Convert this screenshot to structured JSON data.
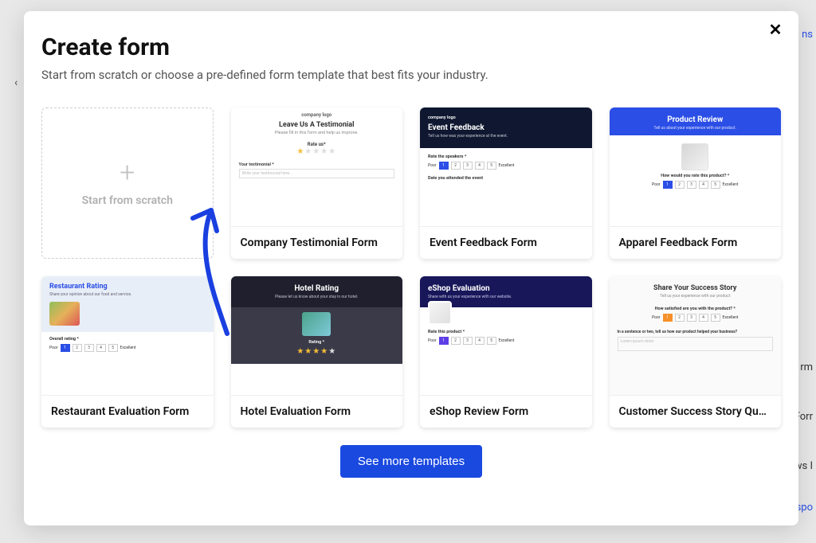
{
  "modal": {
    "title": "Create form",
    "subtitle": "Start from scratch or choose a pre-defined form template that best fits your industry.",
    "close_label": "✕",
    "see_more_label": "See more templates"
  },
  "scratch": {
    "plus": "+",
    "label": "Start from scratch"
  },
  "templates": [
    {
      "id": "testimonial",
      "label": "Company Testimonial Form",
      "preview": {
        "logo": "company logo",
        "title": "Leave Us A Testimonial",
        "subtitle": "Please fill in this form and help us improve.",
        "rate_label": "Rate us*",
        "stars_filled": 1,
        "stars_total": 5,
        "field_label": "Your testimonial *",
        "field_placeholder": "Write your testimonial here..."
      }
    },
    {
      "id": "event",
      "label": "Event Feedback Form",
      "preview": {
        "logo": "company logo",
        "title": "Event Feedback",
        "subtitle": "Tell us how was your experience at the event.",
        "question": "Rate the speakers *",
        "rating_labels": [
          "Poor",
          "1",
          "2",
          "3",
          "4",
          "5",
          "Excellent"
        ],
        "rating_active_index": 1,
        "date_label": "Date you attended the event"
      }
    },
    {
      "id": "apparel",
      "label": "Apparel Feedback Form",
      "preview": {
        "title": "Product Review",
        "subtitle": "Tell us about your experience with our product.",
        "question": "How would you rate this product? *",
        "rating_labels": [
          "Poor",
          "1",
          "2",
          "3",
          "4",
          "5",
          "Excellent"
        ],
        "rating_active_index": 1
      }
    },
    {
      "id": "restaurant",
      "label": "Restaurant Evaluation Form",
      "preview": {
        "title": "Restaurant Rating",
        "subtitle": "Share your opinion about our food and service.",
        "question": "Overall rating *",
        "rating_labels": [
          "Poor",
          "1",
          "2",
          "3",
          "4",
          "5",
          "Excellent"
        ],
        "rating_active_index": 1
      }
    },
    {
      "id": "hotel",
      "label": "Hotel Evaluation Form",
      "preview": {
        "title": "Hotel Rating",
        "subtitle": "Please let us know about your stay in our hotel.",
        "rating_label": "Rating *",
        "stars_filled": 4,
        "stars_total": 5
      }
    },
    {
      "id": "eshop",
      "label": "eShop Review Form",
      "preview": {
        "title": "eShop Evaluation",
        "subtitle": "Share with us your experience with our website.",
        "question": "Rate this product *",
        "rating_labels": [
          "Poor",
          "1",
          "2",
          "3",
          "4",
          "5",
          "Excellent"
        ],
        "rating_active_index": 1
      }
    },
    {
      "id": "story",
      "label": "Customer Success Story Questionnaire",
      "preview": {
        "title": "Share Your Success Story",
        "subtitle": "Tell us your experience with our product",
        "question1": "How satisfied are you with the product? *",
        "rating_labels": [
          "Poor",
          "1",
          "2",
          "3",
          "4",
          "5",
          "Excellent"
        ],
        "rating_active_index": 1,
        "question2": "In a sentence or two, tell us how our product helped your business?",
        "placeholder": "Lorem ipsum dolor"
      }
    }
  ],
  "bg": {
    "right1": "ns",
    "right2": "rm",
    "right3": "Forr",
    "right4": "ws I",
    "right5": "espo"
  }
}
